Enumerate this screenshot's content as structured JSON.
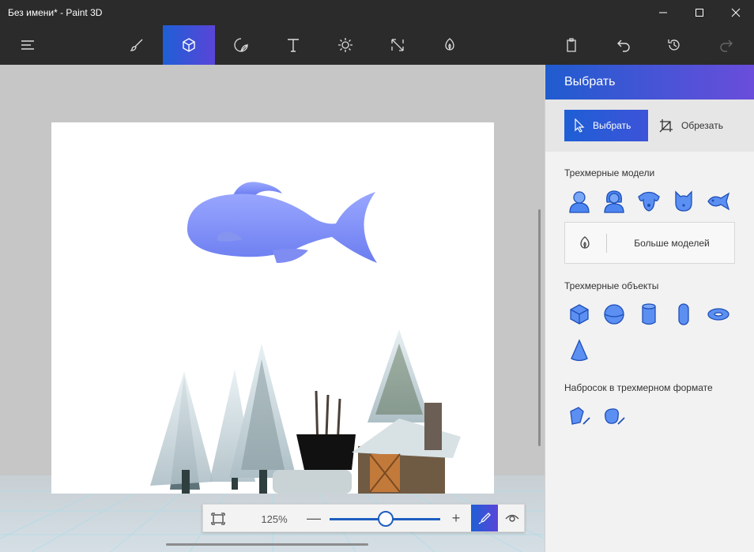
{
  "window": {
    "title": "Без имени* - Paint 3D",
    "minimize_icon": "minimize-icon",
    "maximize_icon": "maximize-icon",
    "close_icon": "close-icon"
  },
  "toolbar": {
    "tools": [
      {
        "name": "menu",
        "icon": "hamburger-menu-icon"
      },
      {
        "name": "brushes",
        "icon": "brush-icon"
      },
      {
        "name": "3d-shapes",
        "icon": "cube-icon",
        "active": true
      },
      {
        "name": "stickers",
        "icon": "sticker-icon"
      },
      {
        "name": "text",
        "icon": "text-icon"
      },
      {
        "name": "effects",
        "icon": "sun-icon"
      },
      {
        "name": "canvas",
        "icon": "canvas-resize-icon"
      },
      {
        "name": "3d-library",
        "icon": "remix-library-icon"
      }
    ],
    "right": [
      {
        "name": "paste",
        "icon": "clipboard-icon"
      },
      {
        "name": "undo",
        "icon": "undo-icon"
      },
      {
        "name": "history",
        "icon": "history-icon"
      },
      {
        "name": "redo",
        "icon": "redo-icon"
      }
    ],
    "accent": "#1e5fd6"
  },
  "zoom": {
    "percent_label": "125%",
    "minus": "—",
    "plus": "+",
    "level": 0.5
  },
  "panel": {
    "title": "Выбрать",
    "select_label": "Выбрать",
    "crop_label": "Обрезать",
    "models_title": "Трехмерные модели",
    "models": [
      "man-model-icon",
      "woman-model-icon",
      "dog-model-icon",
      "cat-model-icon",
      "fish-model-icon"
    ],
    "more_models_label": "Больше моделей",
    "objects_title": "Трехмерные объекты",
    "objects": [
      "cube-object-icon",
      "sphere-object-icon",
      "cylinder-object-icon",
      "capsule-object-icon",
      "torus-object-icon",
      "cone-object-icon"
    ],
    "doodle_title": "Набросок в трехмерном формате",
    "doodles": [
      "sharp-doodle-icon",
      "soft-doodle-icon"
    ],
    "accent_from": "#1f5ccf",
    "accent_to": "#6a4ddb"
  }
}
